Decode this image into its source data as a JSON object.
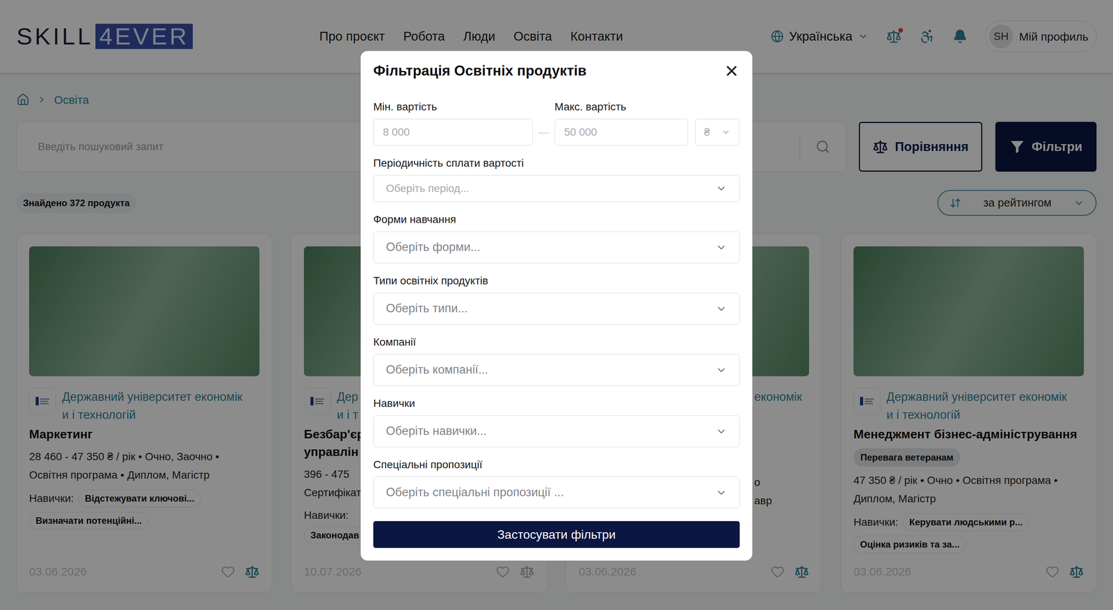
{
  "header": {
    "logo": {
      "left": "SKILL",
      "right": "4EVER"
    },
    "nav": [
      "Про проєкт",
      "Робота",
      "Люди",
      "Освіта",
      "Контакти"
    ],
    "language": "Українська",
    "compare_alert": true,
    "avatar": "SH",
    "profile": "Мій профиль"
  },
  "breadcrumb": {
    "items": [
      "Освіта"
    ]
  },
  "search": {
    "placeholder": "Введіть пошуковий запит"
  },
  "actions": {
    "compare": "Порівняння",
    "filters": "Фільтри"
  },
  "results": {
    "count": "Знайдено 372 продукта",
    "sort": "за рейтингом"
  },
  "cards": [
    {
      "kind": "full",
      "company_lines": [
        "Державний університет економік",
        "и і технологій"
      ],
      "title_lines": [
        "Маркетинг"
      ],
      "badge": "",
      "info_lines": [
        "28 460 - 47 350 ₴ / рік • Очно, Заочно • Освітня програма • Диплом, Магістр"
      ],
      "skills_label": "Навички:",
      "skills": [
        "Відстежувати ключові...",
        "Визначати потенційні..."
      ],
      "date": "03.06.2026",
      "compare_enabled": true
    },
    {
      "kind": "covered-right",
      "company_lines": [
        "Дер",
        "и і т"
      ],
      "title_lines": [
        "Безбар'єр",
        "управлін"
      ],
      "badge": "",
      "info_lines": [
        "396 - 475",
        "Сертифікат"
      ],
      "skills_label": "Навички:",
      "skills": [
        "Законодав"
      ],
      "date": "10.07.2026",
      "compare_enabled": false
    },
    {
      "kind": "covered-left",
      "company_lines": [
        "економік"
      ],
      "title_lines": [],
      "badge": "",
      "info_lines": [
        "о",
        "авр"
      ],
      "skills_label": "",
      "skills": [],
      "date": "03.06.2026",
      "compare_enabled": true
    },
    {
      "kind": "full",
      "company_lines": [
        "Державний університет економік",
        "и і технологій"
      ],
      "title_lines": [
        "Менеджмент бізнес-адміністрування"
      ],
      "badge": "Перевага ветеранам",
      "info_lines": [
        "47 350 ₴ / рік • Очно • Освітня програма • Диплом, Магістр"
      ],
      "skills_label": "Навички:",
      "skills": [
        "Керувати людськими р...",
        "Оцінка ризиків та за..."
      ],
      "date": "03.06.2026",
      "compare_enabled": true
    }
  ],
  "modal": {
    "title": "Фільтрація Освітніх продуктів",
    "min": {
      "label": "Мін. вартість",
      "placeholder": "8 000"
    },
    "separator": "—",
    "max": {
      "label": "Макс. вартість",
      "placeholder": "50 000"
    },
    "currency": "₴",
    "period": {
      "label": "Періодичність сплати вартості",
      "placeholder": "Оберіть період..."
    },
    "selects": [
      {
        "label": "Форми навчання",
        "placeholder": "Оберіть форми..."
      },
      {
        "label": "Типи освітніх продуктів",
        "placeholder": "Оберіть типи..."
      },
      {
        "label": "Компанії",
        "placeholder": "Оберіть компанії..."
      },
      {
        "label": "Навички",
        "placeholder": "Оберіть навички..."
      },
      {
        "label": "Спеціальні пропозиції",
        "placeholder": "Оберіть спеціальні пропозиції ..."
      }
    ],
    "apply": "Застосувати фільтри"
  }
}
